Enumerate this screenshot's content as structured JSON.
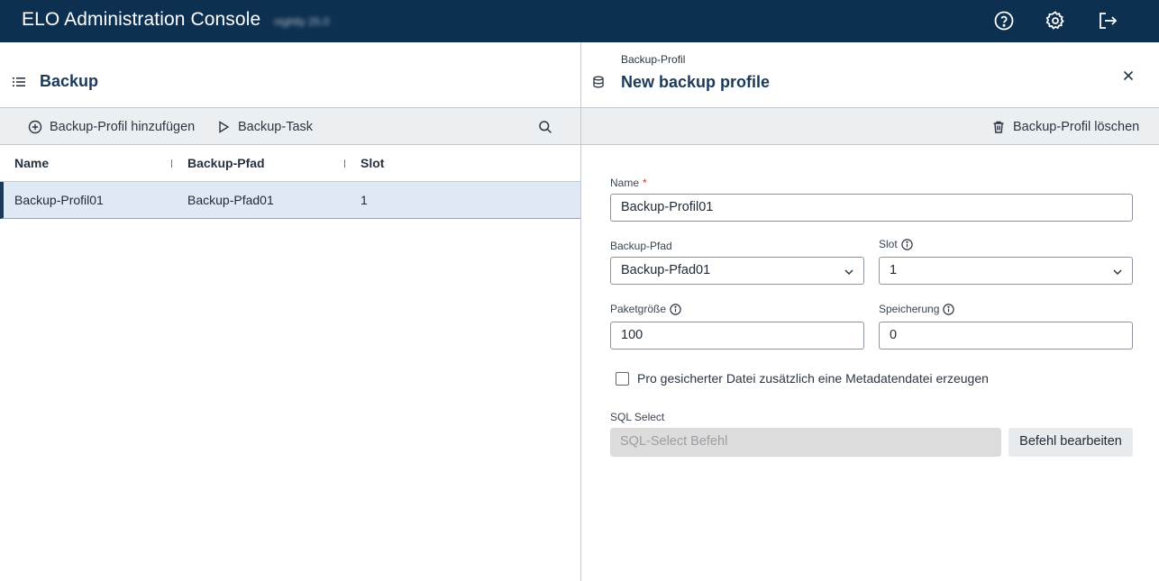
{
  "header": {
    "app_title": "ELO Administration Console",
    "app_subtitle": "nightly 25.0",
    "icons": [
      "help-icon",
      "settings-icon",
      "logout-icon"
    ]
  },
  "left_panel": {
    "title": "Backup",
    "toolbar": {
      "add_label": "Backup-Profil hinzufügen",
      "task_label": "Backup-Task"
    },
    "table": {
      "columns": [
        "Name",
        "Backup-Pfad",
        "Slot"
      ],
      "rows": [
        {
          "name": "Backup-Profil01",
          "path": "Backup-Pfad01",
          "slot": "1"
        }
      ]
    }
  },
  "right_panel": {
    "overline": "Backup-Profil",
    "title": "New backup profile",
    "delete_label": "Backup-Profil löschen",
    "form": {
      "name_label": "Name",
      "name_required_mark": "*",
      "name_value": "Backup-Profil01",
      "path_label": "Backup-Pfad",
      "path_value": "Backup-Pfad01",
      "slot_label": "Slot",
      "slot_value": "1",
      "packet_label": "Paketgröße",
      "packet_value": "100",
      "storage_label": "Speicherung",
      "storage_value": "0",
      "metadata_checkbox_label": "Pro gesicherter Datei zusätzlich eine Metadatendatei erzeugen",
      "metadata_checked": false,
      "sql_label": "SQL Select",
      "sql_placeholder": "SQL-Select Befehl",
      "sql_button": "Befehl bearbeiten"
    }
  },
  "colors": {
    "topbar": "#0d3050",
    "accent": "#1b3a5a",
    "selected_row": "#dfe8f5",
    "toolbar": "#eceff1"
  }
}
